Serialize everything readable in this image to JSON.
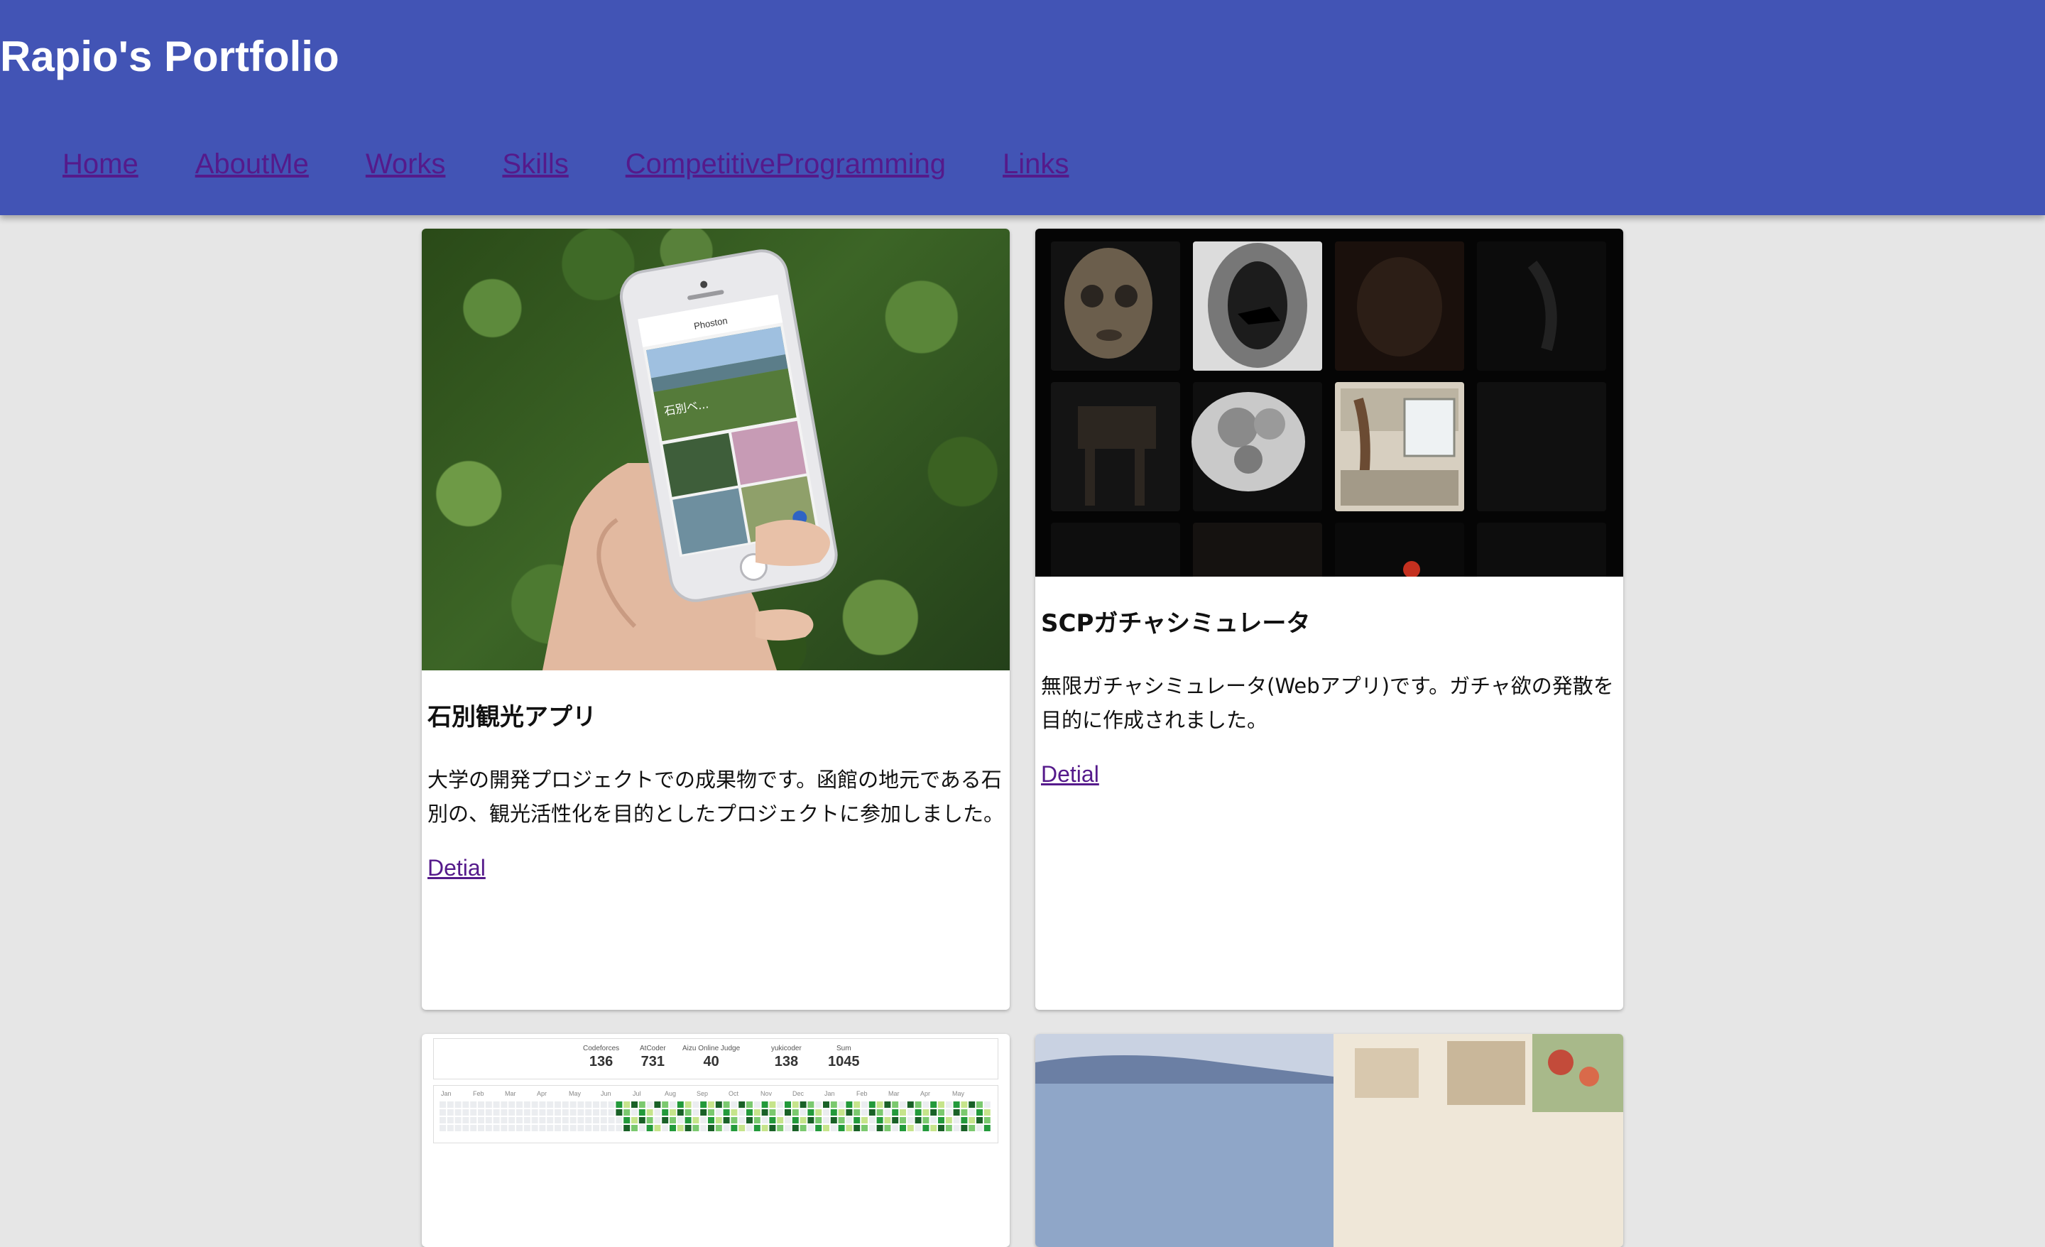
{
  "header": {
    "title": "Rapio's Portfolio",
    "bg_color": "#4254b5",
    "nav": [
      {
        "label": "Home"
      },
      {
        "label": "AboutMe"
      },
      {
        "label": "Works"
      },
      {
        "label": "Skills"
      },
      {
        "label": "CompetitiveProgramming"
      },
      {
        "label": "Links"
      }
    ]
  },
  "works": [
    {
      "title": "石別観光アプリ",
      "description": "大学の開発プロジェクトでの成果物です。函館の地元である石別の、観光活性化を目的としたプロジェクトに参加しました。",
      "link": "Detial",
      "phone_app_title": "Phoston",
      "phone_overlay_text": "石別ベ..."
    },
    {
      "title": "SCPガチャシミュレータ",
      "description": "無限ガチャシミュレータ(Webアプリ)です。ガチャ欲の発散を目的に作成されました。",
      "link": "Detial"
    }
  ],
  "stats_card": {
    "stats": [
      {
        "label": "Codeforces",
        "value": "136"
      },
      {
        "label": "AtCoder",
        "value": "731"
      },
      {
        "label": "Aizu Online Judge",
        "value": "40"
      },
      {
        "label": "yukicoder",
        "value": "138"
      },
      {
        "label": "Sum",
        "value": "1045"
      }
    ],
    "months": [
      "Jan",
      "Feb",
      "Mar",
      "Apr",
      "May",
      "Jun",
      "Jul",
      "Aug",
      "Sep",
      "Oct",
      "Nov",
      "Dec",
      "Jan",
      "Feb",
      "Mar",
      "Apr",
      "May"
    ]
  },
  "colors": {
    "page_bg": "#e6e6e6",
    "link": "#551a8b",
    "heat_levels": [
      "#ebedf0",
      "#c6e48b",
      "#7bc96f",
      "#239a3b",
      "#196127"
    ]
  }
}
